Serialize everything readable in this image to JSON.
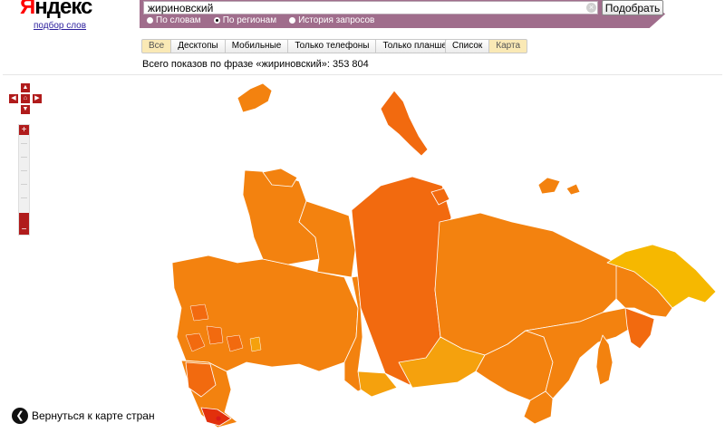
{
  "header": {
    "logo_first": "Я",
    "logo_rest": "ндекс",
    "sublink": "подбор слов"
  },
  "search": {
    "value": "жириновский",
    "submit_label": "Подобрать",
    "radios": [
      {
        "label": "По словам",
        "checked": false
      },
      {
        "label": "По регионам",
        "checked": true
      },
      {
        "label": "История запросов",
        "checked": false
      }
    ]
  },
  "device_tabs": [
    "Все",
    "Десктопы",
    "Мобильные",
    "Только телефоны",
    "Только планшеты"
  ],
  "view_tabs": [
    "Список",
    "Карта"
  ],
  "summary": "Всего показов по фразе «жириновский»: 353 804",
  "map": {
    "back_label": "Вернуться к карте стран",
    "colors": {
      "dark": "#f26a0f",
      "mid": "#f3820f",
      "light": "#f5a10d",
      "yellow": "#f6b800",
      "red": "#e2300c"
    }
  }
}
